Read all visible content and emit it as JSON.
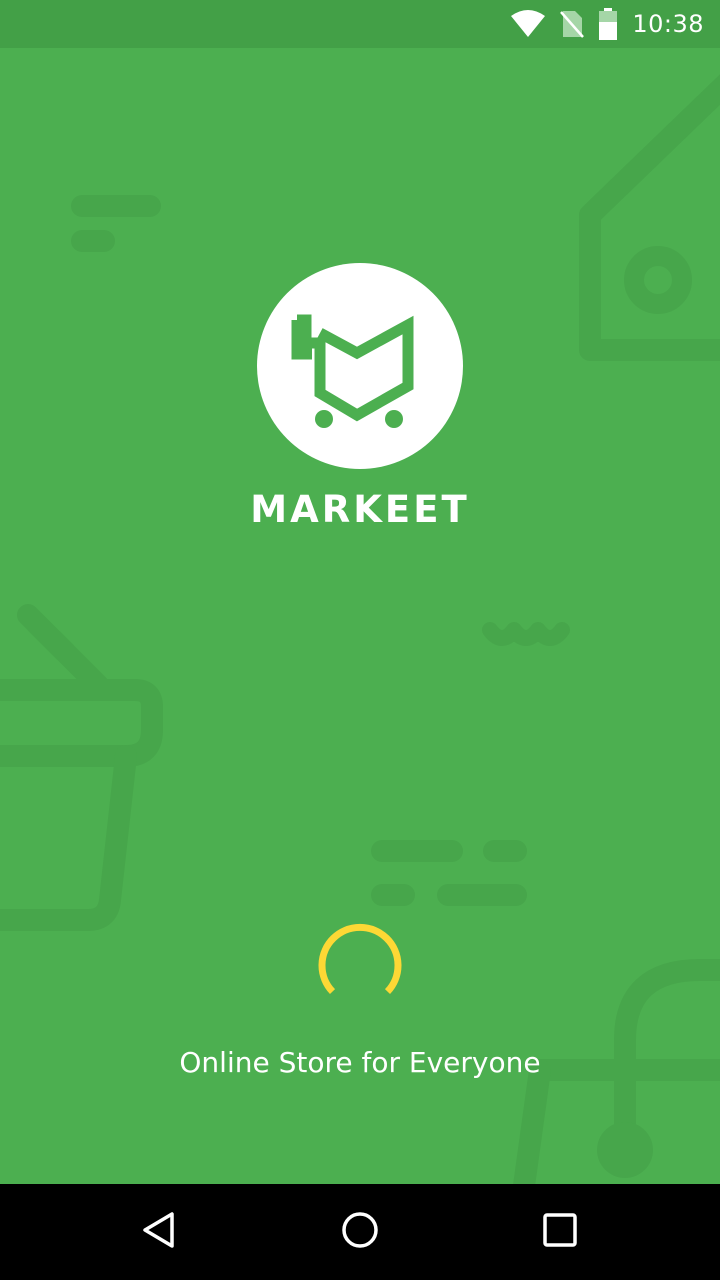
{
  "status_bar": {
    "time": "10:38",
    "icons": [
      "wifi-icon",
      "no-sim-icon",
      "battery-icon"
    ]
  },
  "splash": {
    "app_name": "MARKEET",
    "tagline": "Online Store for Everyone",
    "logo_icon": "shopping-cart-m-logo"
  },
  "navigation_bar": {
    "buttons": [
      "back-icon",
      "home-icon",
      "recents-icon"
    ]
  },
  "colors": {
    "background": "#4caf50",
    "status_bar": "#43a047",
    "decor": "#47a64b",
    "spinner": "#fdd835",
    "logo_circle": "#ffffff",
    "nav_bar": "#000000"
  }
}
